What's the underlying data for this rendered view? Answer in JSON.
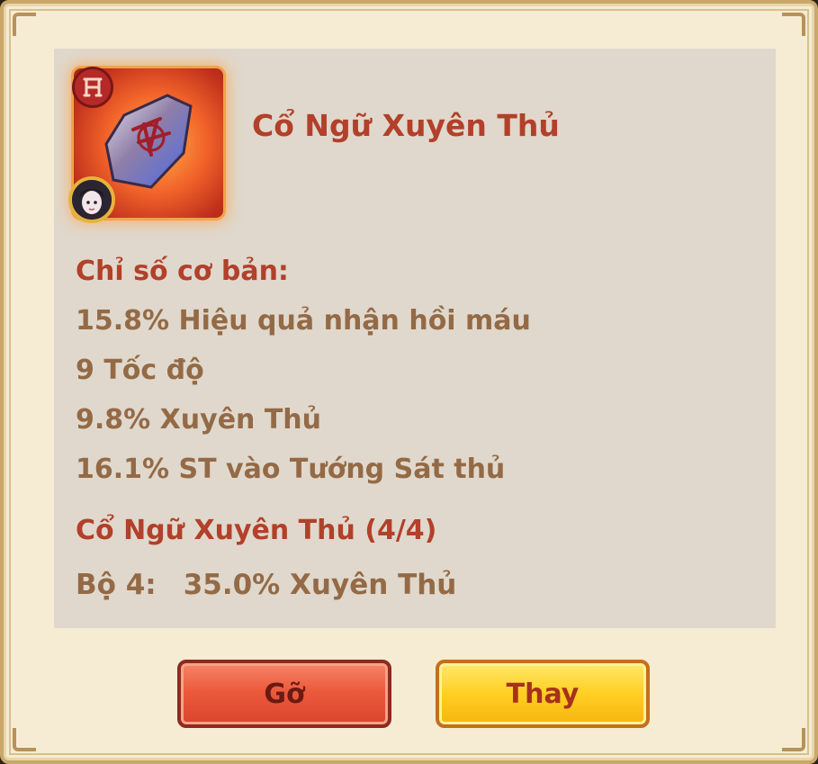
{
  "item": {
    "name": "Cổ Ngữ Xuyên Thủ",
    "icon": "rune-stone-icon",
    "class_badge": "assassin-class-icon",
    "hero_badge": "hero-portrait-avatar"
  },
  "base_stats": {
    "title": "Chỉ số cơ bản:",
    "lines": [
      "15.8% Hiệu quả nhận hồi máu",
      "9 Tốc độ",
      "9.8% Xuyên Thủ",
      "16.1% ST vào Tướng Sát thủ"
    ]
  },
  "set_bonus": {
    "title": "Cổ Ngữ Xuyên Thủ (4/4)",
    "label": "Bộ 4:",
    "value": "35.0% Xuyên Thủ"
  },
  "buttons": {
    "remove_label": "Gỡ",
    "replace_label": "Thay"
  },
  "colors": {
    "title_red": "#b2402a",
    "stat_brown": "#946a46",
    "panel_bg": "#e0d8cc",
    "frame_bg": "#f6ecd4"
  }
}
